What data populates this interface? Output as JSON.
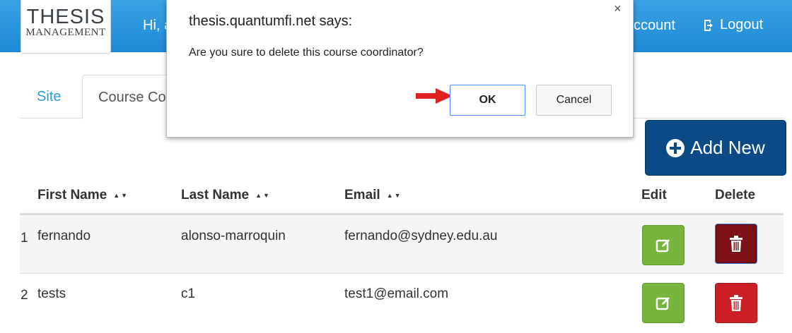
{
  "header": {
    "logo_line1": "THESIS",
    "logo_line2": "MANAGEMENT",
    "greeting": "Hi, a",
    "account_label": "ccount",
    "logout_label": "Logout"
  },
  "tabs": [
    {
      "label": "Site"
    },
    {
      "label": "Course Co"
    }
  ],
  "add_button_label": "Add New",
  "table": {
    "columns": [
      "First Name",
      "Last Name",
      "Email",
      "Edit",
      "Delete"
    ],
    "sort_glyph": "▲▼",
    "rows": [
      {
        "index": "1",
        "first_name": "fernando",
        "last_name": "alonso-marroquin",
        "email": "fernando@sydney.edu.au"
      },
      {
        "index": "2",
        "first_name": "tests",
        "last_name": "c1",
        "email": "test1@email.com"
      }
    ]
  },
  "dialog": {
    "title": "thesis.quantumfi.net says:",
    "message": "Are you sure to delete this course coordinator?",
    "close_glyph": "×",
    "ok_label": "OK",
    "cancel_label": "Cancel"
  },
  "colors": {
    "header": "#1e8ad6",
    "add_button": "#0b4a86",
    "edit_button": "#77b43c",
    "delete_button": "#cc1f26",
    "arrow": "#e02020"
  },
  "icons": {
    "logout": "logout-icon",
    "add": "plus-circle-icon",
    "edit": "edit-icon",
    "delete": "trash-icon",
    "close": "close-icon",
    "pointer": "red-arrow-icon"
  }
}
